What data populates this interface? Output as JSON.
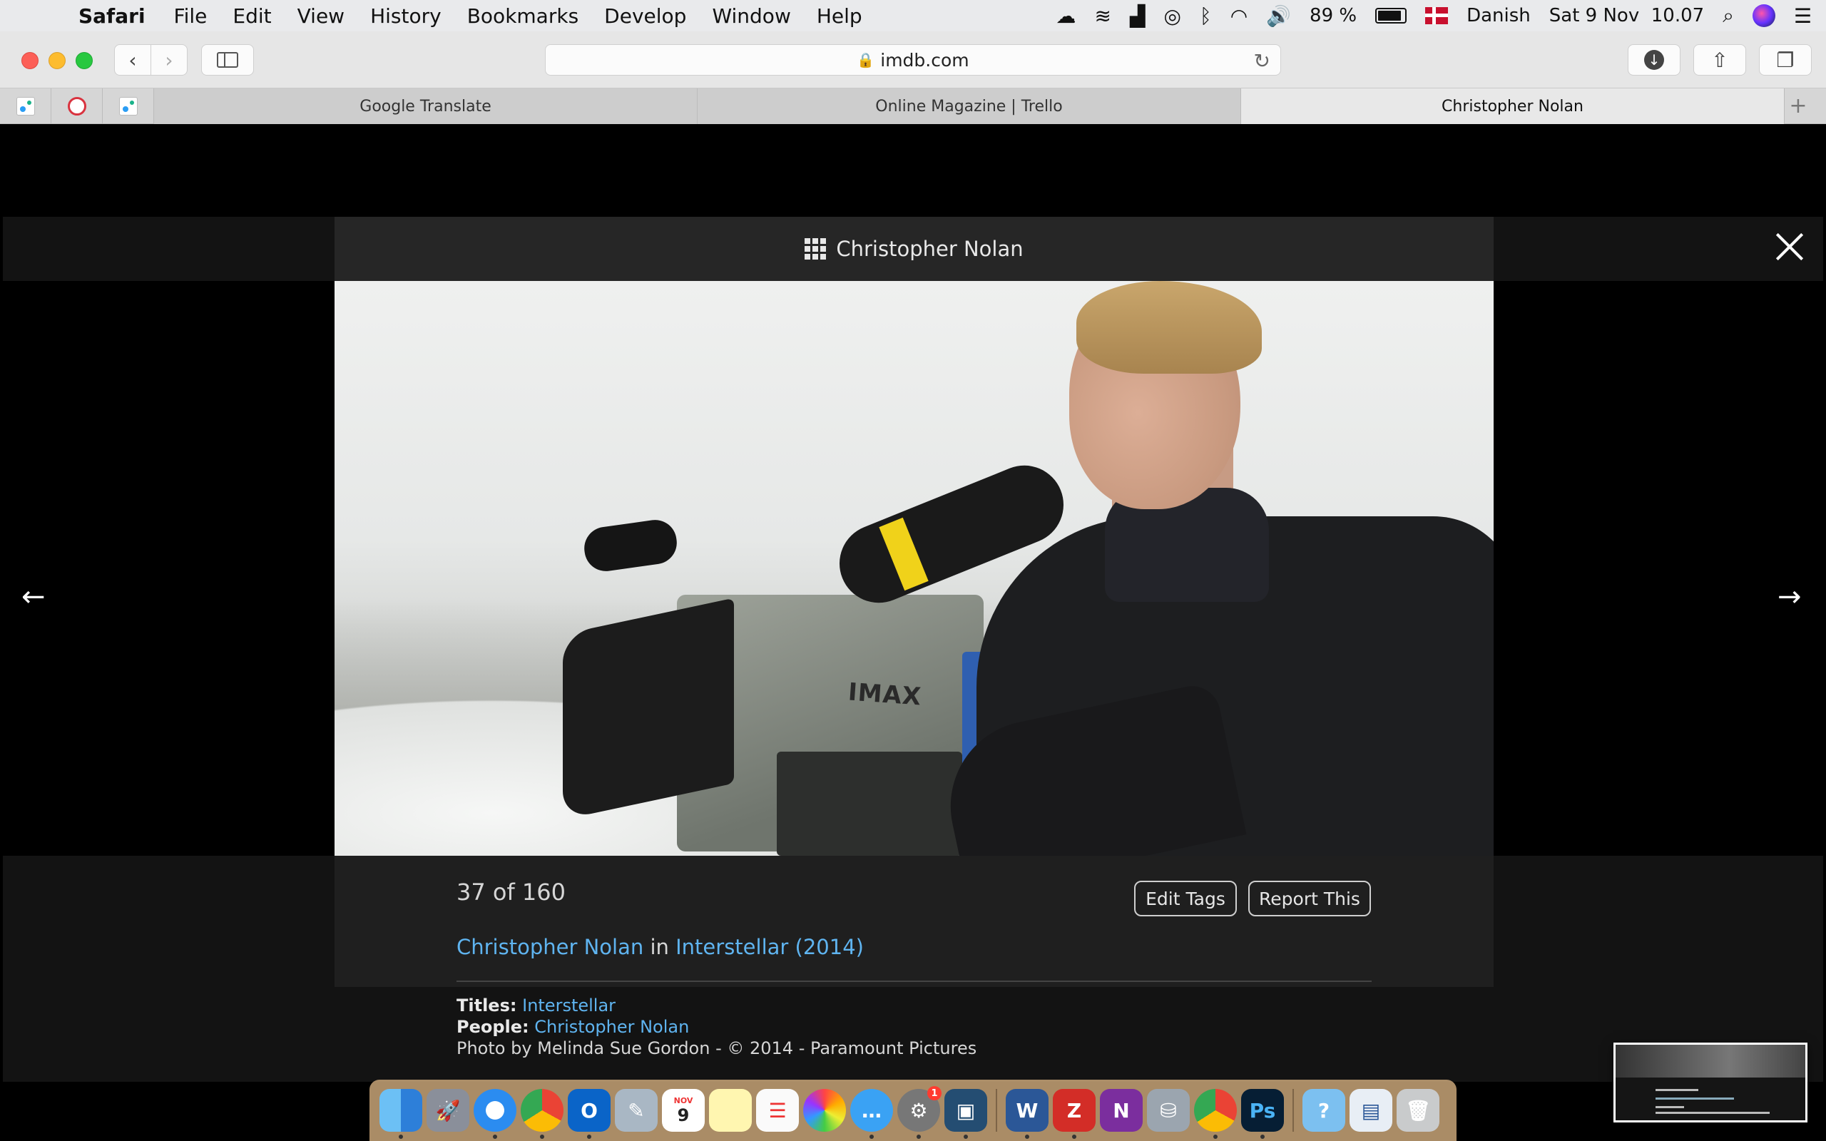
{
  "menubar": {
    "app_name": "Safari",
    "items": [
      "File",
      "Edit",
      "View",
      "History",
      "Bookmarks",
      "Develop",
      "Window",
      "Help"
    ],
    "battery_percent": "89 %",
    "battery_level": 0.89,
    "input_language": "Danish",
    "datetime": "Sat 9 Nov  10.07"
  },
  "toolbar": {
    "address": "imdb.com"
  },
  "tabs": [
    {
      "label": "Google Translate",
      "active": false
    },
    {
      "label": "Online Magazine | Trello",
      "active": false
    },
    {
      "label": "Christopher Nolan",
      "active": true
    }
  ],
  "gallery": {
    "title": "Christopher Nolan",
    "counter": "37 of 160",
    "edit_tags_label": "Edit Tags",
    "report_label": "Report This",
    "caption": {
      "person_link": "Christopher Nolan",
      "connector": "in",
      "title_link": "Interstellar (2014)"
    },
    "titles_label": "Titles:",
    "titles_value": "Interstellar",
    "people_label": "People:",
    "people_value": "Christopher Nolan",
    "credit": "Photo by Melinda Sue Gordon - © 2014 - Paramount Pictures",
    "photo_text": "IMAX"
  },
  "dock": {
    "calendar_month": "NOV",
    "calendar_day": "9",
    "badge_count": "1"
  },
  "colors": {
    "link": "#5fb4f0",
    "menubar_bg": "#e9eaec",
    "page_bg": "#000000",
    "panel_bg": "#262626"
  }
}
